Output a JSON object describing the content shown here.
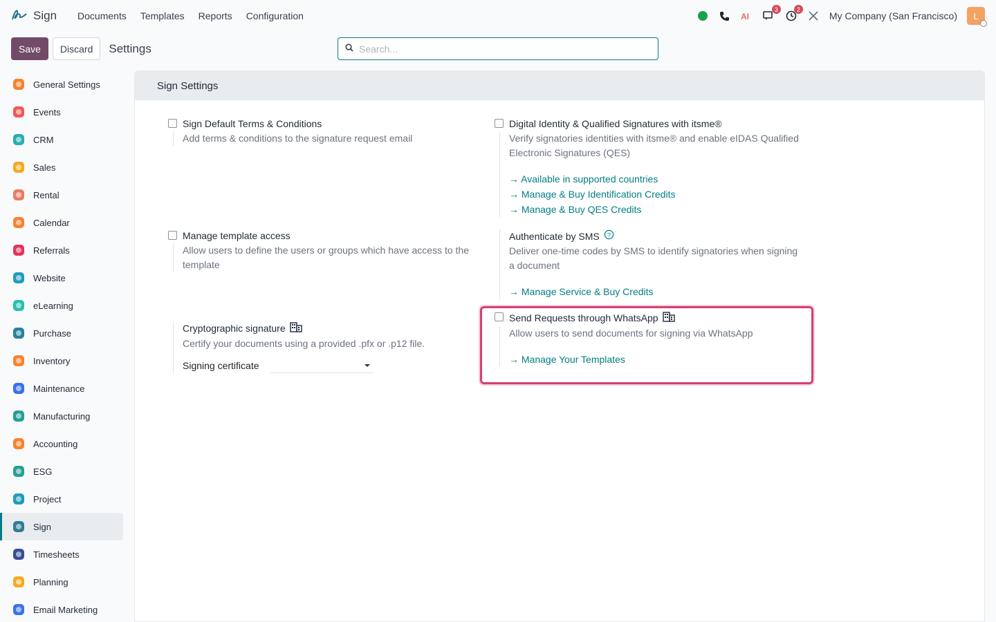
{
  "topbar": {
    "app_name": "Sign",
    "menu": [
      "Documents",
      "Templates",
      "Reports",
      "Configuration"
    ],
    "company": "My Company (San Francisco)",
    "avatar_letter": "L",
    "chat_badge": "3",
    "activity_badge": "2"
  },
  "control": {
    "save_label": "Save",
    "discard_label": "Discard",
    "title": "Settings",
    "search_placeholder": "Search..."
  },
  "sidebar": {
    "items": [
      {
        "label": "General Settings",
        "icon": "general-settings-icon",
        "color": "#f97316"
      },
      {
        "label": "Events",
        "icon": "events-icon",
        "color": "#ef4444"
      },
      {
        "label": "CRM",
        "icon": "crm-icon",
        "color": "#0ea5a4"
      },
      {
        "label": "Sales",
        "icon": "sales-icon",
        "color": "#f59e0b"
      },
      {
        "label": "Rental",
        "icon": "rental-icon",
        "color": "#e76f51"
      },
      {
        "label": "Calendar",
        "icon": "calendar-icon",
        "color": "#f97316"
      },
      {
        "label": "Referrals",
        "icon": "referrals-icon",
        "color": "#e11d48"
      },
      {
        "label": "Website",
        "icon": "website-icon",
        "color": "#0891b2"
      },
      {
        "label": "eLearning",
        "icon": "elearning-icon",
        "color": "#14b8a6"
      },
      {
        "label": "Purchase",
        "icon": "purchase-icon",
        "color": "#0e7490"
      },
      {
        "label": "Inventory",
        "icon": "inventory-icon",
        "color": "#f97316"
      },
      {
        "label": "Maintenance",
        "icon": "maintenance-icon",
        "color": "#2563eb"
      },
      {
        "label": "Manufacturing",
        "icon": "manufacturing-icon",
        "color": "#0d9488"
      },
      {
        "label": "Accounting",
        "icon": "accounting-icon",
        "color": "#f97316"
      },
      {
        "label": "ESG",
        "icon": "esg-icon",
        "color": "#0d9488"
      },
      {
        "label": "Project",
        "icon": "project-icon",
        "color": "#0891b2"
      },
      {
        "label": "Sign",
        "icon": "sign-icon",
        "color": "#1e6f8e"
      },
      {
        "label": "Timesheets",
        "icon": "timesheets-icon",
        "color": "#1e3a8a"
      },
      {
        "label": "Planning",
        "icon": "planning-icon",
        "color": "#f59e0b"
      },
      {
        "label": "Email Marketing",
        "icon": "email-marketing-icon",
        "color": "#2563eb"
      }
    ],
    "active": "Sign"
  },
  "panel": {
    "header": "Sign Settings",
    "settings": {
      "terms": {
        "title": "Sign Default Terms & Conditions",
        "desc": "Add terms & conditions to the signature request email"
      },
      "itsme": {
        "title": "Digital Identity & Qualified Signatures with itsme®",
        "desc1": "Verify signatories identities with itsme® and enable eIDAS Qualified",
        "desc2": "Electronic Signatures (QES)",
        "link1": "Available in supported countries",
        "link2": "Manage & Buy Identification Credits",
        "link3": "Manage & Buy QES Credits"
      },
      "template_access": {
        "title": "Manage template access",
        "desc1": "Allow users to define the users or groups which have access to the",
        "desc2": "template"
      },
      "sms": {
        "title": "Authenticate by SMS",
        "desc1": "Deliver one-time codes by SMS to identify signatories when signing",
        "desc2": "a document",
        "link1": "Manage Service & Buy Credits"
      },
      "crypto": {
        "title": "Cryptographic signature",
        "desc": "Certify your documents using a provided .pfx or .p12 file.",
        "field_label": "Signing certificate",
        "field_value": ""
      },
      "whatsapp": {
        "title": "Send Requests through WhatsApp",
        "desc": "Allow users to send documents for signing via WhatsApp",
        "link1": "Manage Your Templates"
      }
    }
  },
  "colors": {
    "primary": "#714b67",
    "link": "#017e84",
    "highlight": "#d63e74"
  }
}
